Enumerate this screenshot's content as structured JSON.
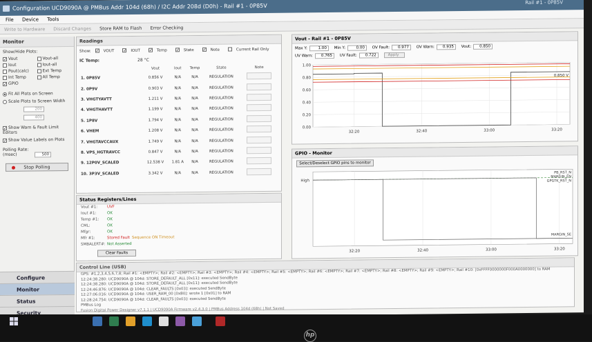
{
  "window": {
    "title": "Configuration UCD9090A @ PMBus Addr 104d (68h) / I2C Addr 208d (D0h) - Rail #1 - 0P85V",
    "top_right": "Rail #1 - 0P85V"
  },
  "menu": [
    "File",
    "Device",
    "Tools"
  ],
  "toolbar": {
    "write": "Write to Hardware",
    "discard": "Discard Changes",
    "store": "Store RAM to Flash",
    "error": "Error Checking"
  },
  "monitor": {
    "title": "Monitor",
    "show_hide": "Show/Hide Plots:",
    "plots": [
      {
        "label": "Vout",
        "checked": true
      },
      {
        "label": "Vout-all",
        "checked": false
      },
      {
        "label": "Iout",
        "checked": false
      },
      {
        "label": "Iout-all",
        "checked": false
      },
      {
        "label": "Pout(calc)",
        "checked": false
      },
      {
        "label": "Ext Temp",
        "checked": false
      },
      {
        "label": "Int Temp",
        "checked": false
      },
      {
        "label": "All Temp",
        "checked": false
      },
      {
        "label": "GPIO",
        "checked": true
      }
    ],
    "fit_all": "Fit All Plots on Screen",
    "scale": "Scale Plots to Screen Width",
    "scale_w1": "200",
    "scale_w2": "400",
    "show_warn": "Show Warn & Fault Limit Editors",
    "show_labels": "Show Value Labels on Plots",
    "polling_label": "Polling Rate: (msec)",
    "polling_value": "500",
    "stop": "Stop Polling"
  },
  "nav": [
    "Configure",
    "Monitor",
    "Status",
    "Security"
  ],
  "readings": {
    "title": "Readings",
    "show": "Show:",
    "toggles": [
      {
        "label": "VOUT",
        "checked": true
      },
      {
        "label": "IOUT",
        "checked": true
      },
      {
        "label": "Temp",
        "checked": true
      },
      {
        "label": "State",
        "checked": true
      },
      {
        "label": "Note",
        "checked": true
      },
      {
        "label": "Current Rail Only",
        "checked": false
      }
    ],
    "ic_temp_label": "IC Temp:",
    "ic_temp_value": "28 °C",
    "headers": [
      "Vout",
      "Iout",
      "Temp",
      "State",
      "Note"
    ],
    "rows": [
      {
        "name": "1. 0P85V",
        "vout": "0.856 V",
        "iout": "N/A",
        "temp": "N/A",
        "state": "REGULATION"
      },
      {
        "name": "2. 0P9V",
        "vout": "0.903 V",
        "iout": "N/A",
        "temp": "N/A",
        "state": "REGULATION"
      },
      {
        "name": "3. VHGTYAVTT",
        "vout": "1.211 V",
        "iout": "N/A",
        "temp": "N/A",
        "state": "REGULATION"
      },
      {
        "name": "4. VHGTHAVTT",
        "vout": "1.199 V",
        "iout": "N/A",
        "temp": "N/A",
        "state": "REGULATION"
      },
      {
        "name": "5. 1P8V",
        "vout": "1.794 V",
        "iout": "N/A",
        "temp": "N/A",
        "state": "REGULATION"
      },
      {
        "name": "6. VHEM",
        "vout": "1.208 V",
        "iout": "N/A",
        "temp": "N/A",
        "state": "REGULATION"
      },
      {
        "name": "7. VHGTAVCCAUX",
        "vout": "1.749 V",
        "iout": "N/A",
        "temp": "N/A",
        "state": "REGULATION"
      },
      {
        "name": "8. VPS_HGTRAVCC",
        "vout": "0.847 V",
        "iout": "N/A",
        "temp": "N/A",
        "state": "REGULATION"
      },
      {
        "name": "9. 12P0V_SCALED",
        "vout": "12.538 V",
        "iout": "1.81 A",
        "temp": "N/A",
        "state": "REGULATION"
      },
      {
        "name": "10. 3P3V_SCALED",
        "vout": "3.342 V",
        "iout": "N/A",
        "temp": "N/A",
        "state": "REGULATION"
      }
    ]
  },
  "status": {
    "title": "Status Registers/Lines",
    "rows": [
      {
        "key": "Vout #1:",
        "val": "UVF",
        "cls": "bad"
      },
      {
        "key": "Iout #1:",
        "val": "OK",
        "cls": "ok"
      },
      {
        "key": "Temp #1:",
        "val": "OK",
        "cls": "ok"
      },
      {
        "key": "CML:",
        "val": "OK",
        "cls": "ok"
      },
      {
        "key": "Mfgr:",
        "val": "OK",
        "cls": "ok"
      },
      {
        "key": "Mfr #1:",
        "val": "Stored Fault",
        "extra": "Sequence ON Timeout",
        "cls": "bad"
      },
      {
        "key": "SMBALERT#:",
        "val": "Not Asserted",
        "cls": "ok"
      }
    ],
    "clear": "Clear Faults"
  },
  "control_line": {
    "title": "Control Line (USB)",
    "lines": [
      "GPS: #1,2,3,4,5,6,7,8; Rail #1: <EMPTY>; Rail #2: <EMPTY>; Rail #3: <EMPTY>; Rail #4: <EMPTY>; Rail #5: <EMPTY>; Rail #6: <EMPTY>; Rail #7: <EMPTY>; Rail #8: <EMPTY>; Rail #9: <EMPTY>; Rail #10: [0xFFFF0000000F000A0000000] to RAM",
      "12:24:38.280: UCD9090A @ 104d: STORE_DEFAULT_ALL [0x11]: executed SendByte",
      "12:24:38.280: UCD9090A @ 104d: STORE_DEFAULT_ALL [0x11]: executed SendByte",
      "12:24:46.876: UCD9090A @ 104d: CLEAR_FAULTS [0x03]: executed SendByte",
      "12:27:06.016: UCD9090A @ 104d: USER_RAM_00 [0xB0]: wrote 1 [0x01] to RAM",
      "12:28:24.754: UCD9090A @ 104d: CLEAR_FAULTS [0x03]: executed SendByte",
      "PMBus Log"
    ],
    "status_bar": "Fusion Digital Power Designer v7.1.1 | UCD9090A Firmware v2.4.3.0 | PMBus Address 104d (68h) | Not Saved"
  },
  "vout_plot": {
    "title": "Vout - Rail #1 - 0P85V",
    "max_y_label": "Max Y:",
    "max_y": "1.00",
    "min_y_label": "Min Y:",
    "min_y": "0.00",
    "ov_fault_label": "OV Fault:",
    "ov_fault": "0.977",
    "ov_warn_label": "OV Warn:",
    "ov_warn": "0.935",
    "vout_label": "Vout:",
    "vout": "0.850",
    "uv_warn_label": "UV Warn:",
    "uv_warn": "0.765",
    "uv_fault_label": "UV Fault:",
    "uv_fault": "0.722",
    "unit": "V",
    "apply": "Apply"
  },
  "gpio_plot": {
    "title": "GPIO - Monitor",
    "select_btn": "Select/Deselect GPIO pins to monitor",
    "high": "High",
    "labels": [
      "PB_RST_N",
      "MARGIN_EN",
      "GPGTK_RST_N",
      "MARGIN_SE"
    ]
  },
  "chart_data": [
    {
      "type": "line",
      "title": "Vout - Rail #1 - 0P85V",
      "x": [
        "32:20",
        "32:40",
        "33:00",
        "33:20"
      ],
      "ylim": [
        0,
        1.0
      ],
      "yticks": [
        0.0,
        0.2,
        0.4,
        0.6,
        0.8,
        1.0
      ],
      "value_label": "0.850 V",
      "series": [
        {
          "name": "OV Fault",
          "color": "#d02020",
          "points": [
            [
              0,
              0.977
            ],
            [
              1,
              0.977
            ]
          ]
        },
        {
          "name": "OV Warn",
          "color": "#e3a11a",
          "points": [
            [
              0,
              0.935
            ],
            [
              1,
              0.935
            ]
          ]
        },
        {
          "name": "Vout",
          "color": "#555555",
          "points": [
            [
              0,
              0.85
            ],
            [
              0.16,
              0.85
            ],
            [
              0.16,
              0.858
            ],
            [
              0.27,
              0.858
            ],
            [
              0.27,
              0.0
            ],
            [
              0.77,
              0.0
            ],
            [
              0.77,
              0.85
            ],
            [
              1,
              0.85
            ]
          ]
        },
        {
          "name": "UV Warn",
          "color": "#e3a11a",
          "points": [
            [
              0,
              0.765
            ],
            [
              1,
              0.765
            ]
          ]
        },
        {
          "name": "UV Fault",
          "color": "#d02020",
          "points": [
            [
              0,
              0.722
            ],
            [
              1,
              0.722
            ]
          ]
        }
      ]
    },
    {
      "type": "line",
      "title": "GPIO - Monitor",
      "x": [
        "32:20",
        "32:40",
        "33:00",
        "33:20"
      ],
      "series": [
        {
          "name": "PB_RST_N",
          "points": [
            [
              0,
              1
            ],
            [
              0.27,
              1
            ],
            [
              0.27,
              0
            ],
            [
              1,
              0
            ]
          ]
        },
        {
          "name": "MARGIN_EN",
          "points": [
            [
              0,
              1
            ],
            [
              0.86,
              1
            ],
            [
              0.86,
              0
            ],
            [
              1,
              0
            ]
          ]
        }
      ]
    }
  ]
}
